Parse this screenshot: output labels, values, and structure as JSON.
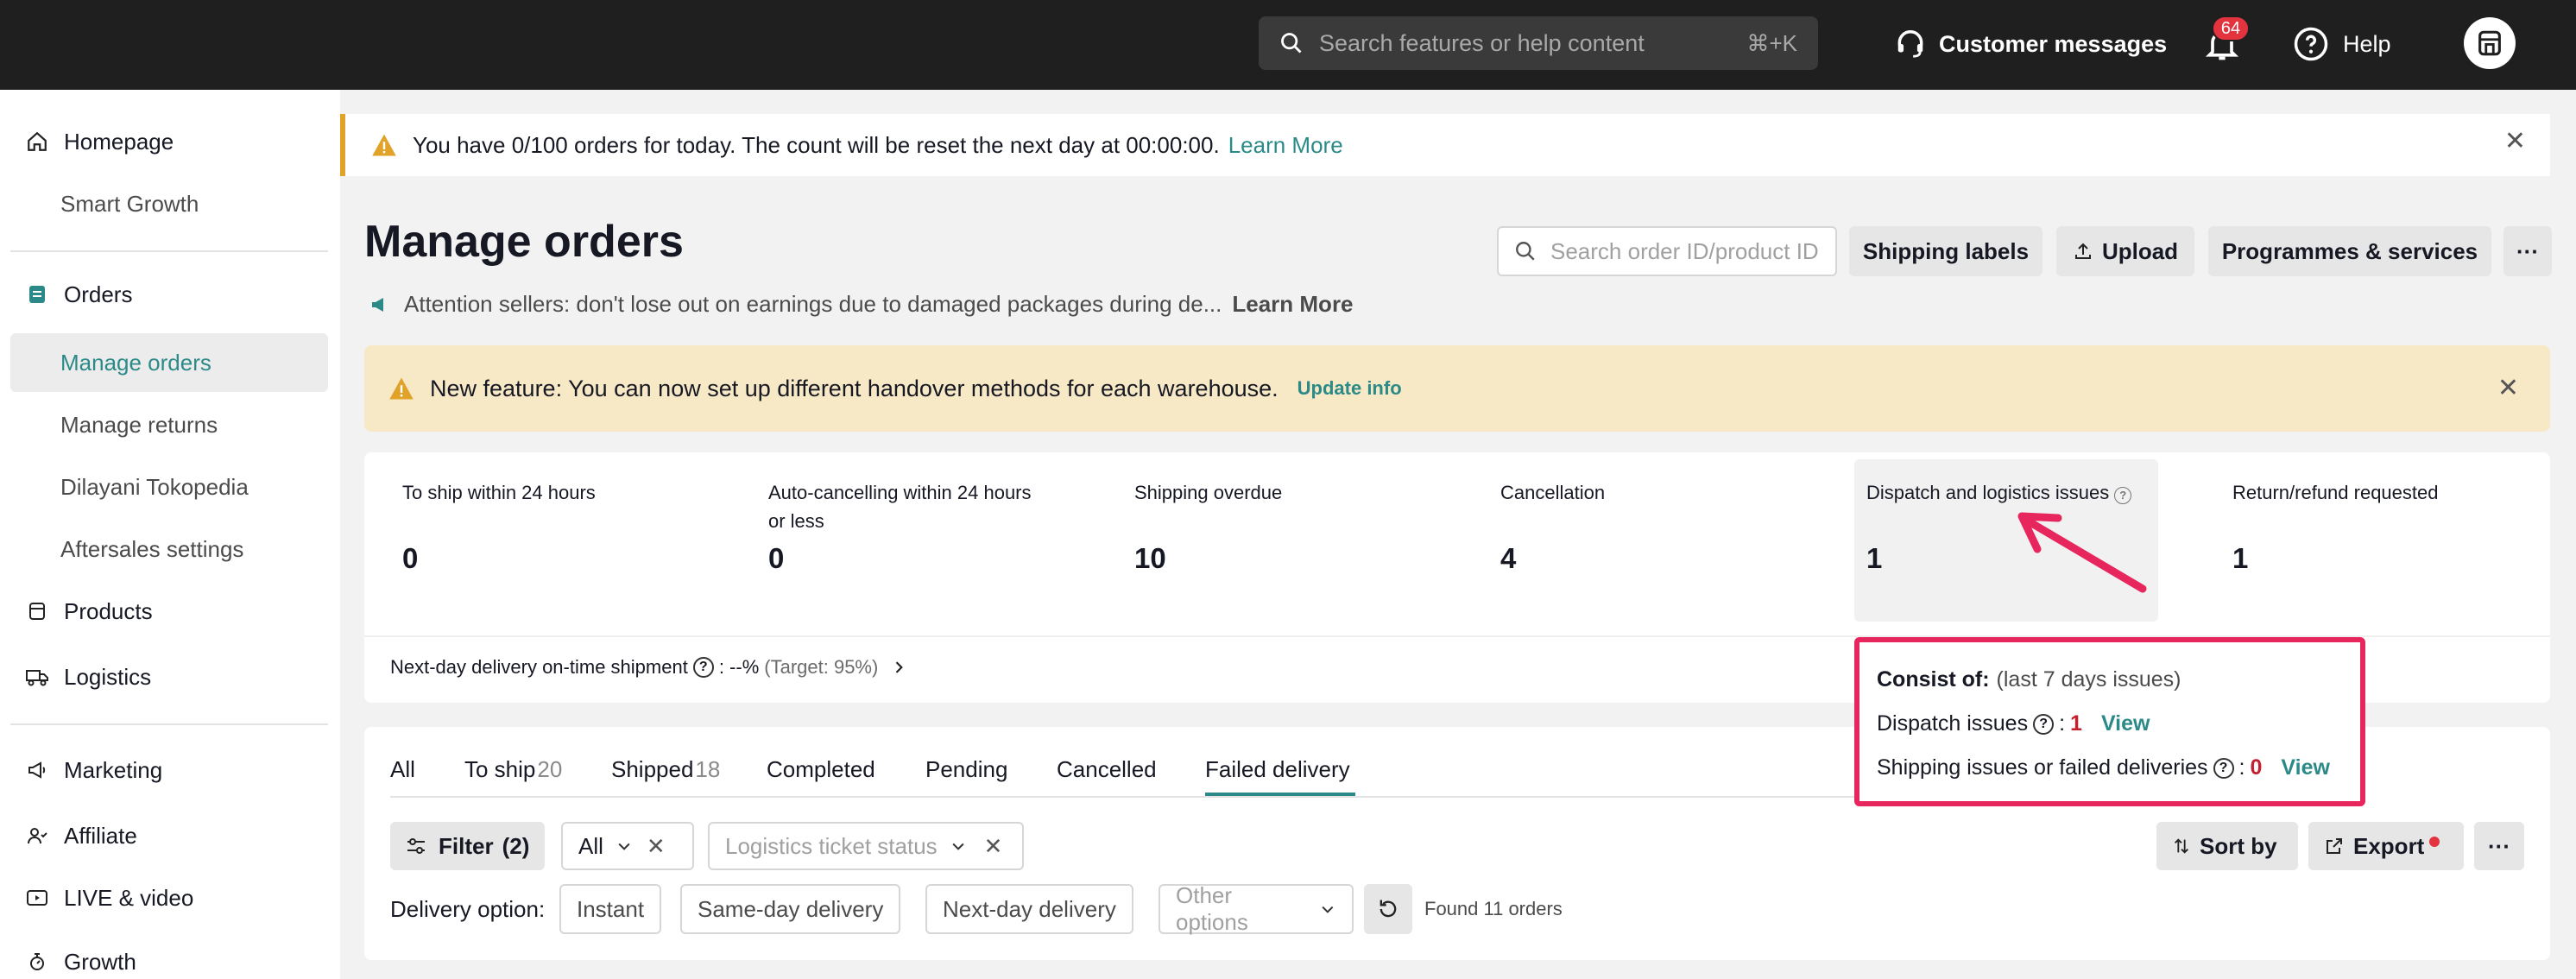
{
  "topbar": {
    "search_placeholder": "Search features or help content",
    "search_shortcut": "⌘+K",
    "customer_messages": "Customer messages",
    "notifications_count": "64",
    "help": "Help"
  },
  "sidebar": {
    "items": [
      {
        "label": "Homepage",
        "icon": "home-icon"
      },
      {
        "label": "Smart Growth"
      },
      {
        "label": "Orders",
        "icon": "orders-icon"
      },
      {
        "label": "Manage orders",
        "active": true
      },
      {
        "label": "Manage returns"
      },
      {
        "label": "Dilayani Tokopedia"
      },
      {
        "label": "Aftersales settings"
      },
      {
        "label": "Products",
        "icon": "products-icon"
      },
      {
        "label": "Logistics",
        "icon": "truck-icon"
      },
      {
        "label": "Marketing",
        "icon": "megaphone-icon"
      },
      {
        "label": "Affiliate",
        "icon": "affiliate-icon"
      },
      {
        "label": "LIVE & video",
        "icon": "video-icon"
      },
      {
        "label": "Growth",
        "icon": "growth-icon"
      }
    ]
  },
  "top_banner": {
    "text": "You have 0/100 orders for today. The count will be reset the next day at 00:00:00.",
    "link": "Learn More"
  },
  "page": {
    "title": "Manage orders",
    "attention": "Attention sellers: don't lose out on earnings due to damaged packages during de...",
    "attention_link": "Learn More",
    "order_search_placeholder": "Search order ID/product ID",
    "shipping_labels": "Shipping labels",
    "upload": "Upload",
    "programmes": "Programmes & services",
    "more": "···"
  },
  "feature_banner": {
    "text": "New feature: You can now set up different handover methods for each warehouse.",
    "link": "Update info"
  },
  "stats": [
    {
      "label": "To ship within 24 hours",
      "value": "0"
    },
    {
      "label": "Auto-cancelling within 24 hours or less",
      "value": "0"
    },
    {
      "label": "Shipping overdue",
      "value": "10"
    },
    {
      "label": "Cancellation",
      "value": "4"
    },
    {
      "label": "Dispatch and logistics issues",
      "value": "1"
    },
    {
      "label": "Return/refund requested",
      "value": "1"
    }
  ],
  "next_day": {
    "label": "Next-day delivery on-time shipment",
    "value": ": --%",
    "target": "(Target: 95%)"
  },
  "tabs": [
    {
      "label": "All"
    },
    {
      "label": "To ship",
      "count": "20"
    },
    {
      "label": "Shipped",
      "count": "18"
    },
    {
      "label": "Completed"
    },
    {
      "label": "Pending"
    },
    {
      "label": "Cancelled"
    },
    {
      "label": "Failed delivery",
      "active": true
    }
  ],
  "filters": {
    "filter": "Filter",
    "filter_count": "(2)",
    "all": "All",
    "logistics_placeholder": "Logistics ticket status",
    "sort_by": "Sort by",
    "export": "Export",
    "delivery_label": "Delivery option:",
    "instant": "Instant",
    "same_day": "Same-day delivery",
    "next_day": "Next-day delivery",
    "other_placeholder": "Other options",
    "found": "Found 11 orders"
  },
  "popover": {
    "title": "Consist of:",
    "subtitle": "(last 7 days issues)",
    "dispatch_label": "Dispatch issues",
    "dispatch_value": "1",
    "shipping_label": "Shipping issues or failed deliveries",
    "shipping_value": "0",
    "view": "View"
  },
  "colors": {
    "accent": "#2b8a88",
    "highlight_border": "#e8265e",
    "warning": "#e1a22a",
    "badge": "#e2333f"
  }
}
